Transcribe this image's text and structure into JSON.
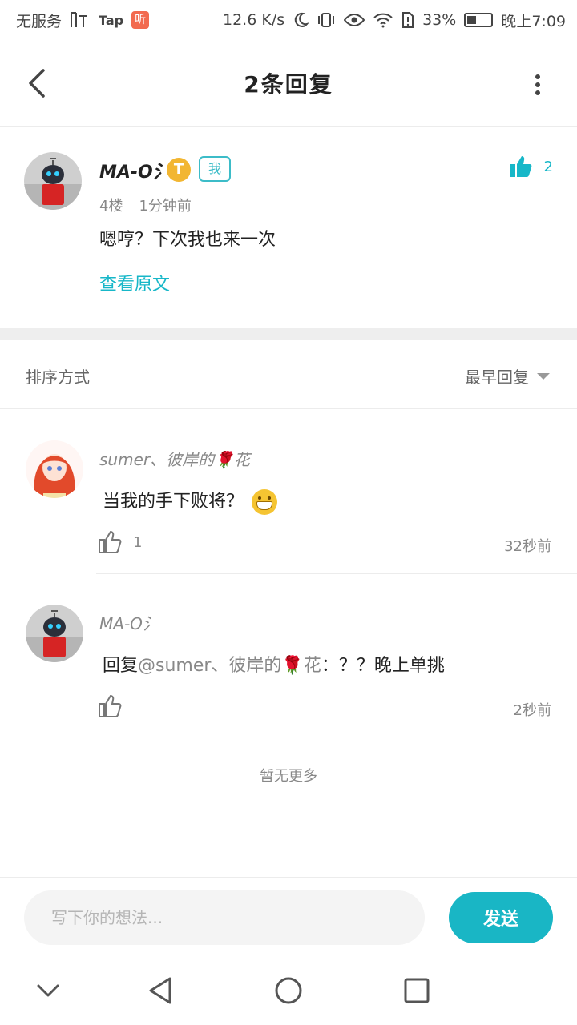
{
  "status_bar": {
    "left_text": "无服务",
    "tap_label": "Tap",
    "badge_label": "听",
    "speed": "12.6 K/s",
    "battery": "33%",
    "time": "晚上7:09"
  },
  "header": {
    "title": "2条回复"
  },
  "main_comment": {
    "author": "MA-O氵",
    "vip_badge": "T",
    "me_tag": "我",
    "likes": "2",
    "floor": "4楼",
    "time": "1分钟前",
    "text": "嗯哼？下次我也来一次",
    "view_original": "查看原文"
  },
  "sort": {
    "label": "排序方式",
    "selected": "最早回复"
  },
  "replies": [
    {
      "author": "sumer、彼岸的🌹花",
      "text": "当我的手下败将？",
      "likes": "1",
      "time": "32秒前"
    },
    {
      "author": "MA-O氵",
      "reply_prefix": "回复",
      "mention": "@sumer、彼岸的🌹花",
      "text": "：？？晚上单挑",
      "likes": "",
      "time": "2秒前"
    }
  ],
  "footer": {
    "no_more": "暂无更多",
    "input_placeholder": "写下你的想法...",
    "send_label": "发送"
  },
  "colors": {
    "accent": "#19b6c5",
    "divider": "#eeeeee"
  }
}
